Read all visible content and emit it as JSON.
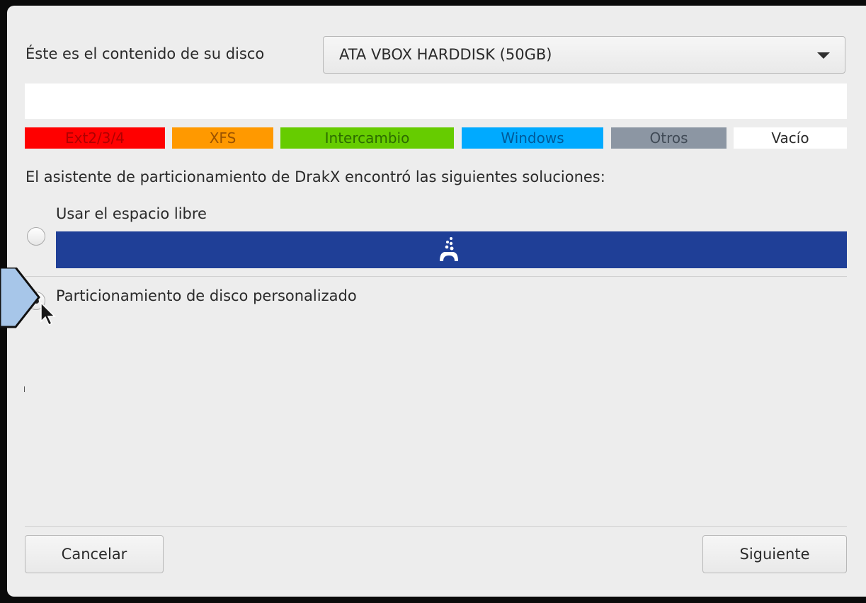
{
  "disk": {
    "label": "Éste es el contenido de su disco",
    "selected": "ATA VBOX HARDDISK (50GB)"
  },
  "legend": [
    {
      "label": "Ext2/3/4",
      "color": "#ff0000",
      "text_color": "#b00000"
    },
    {
      "label": "XFS",
      "color": "#ff9900",
      "text_color": "#9a5200"
    },
    {
      "label": "Intercambio",
      "color": "#66cc00",
      "text_color": "#2c6b00"
    },
    {
      "label": "Windows",
      "color": "#00aaff",
      "text_color": "#005a99"
    },
    {
      "label": "Otros",
      "color": "#8c96a3",
      "text_color": "#404a56"
    },
    {
      "label": "Vacío",
      "color": "#ffffff",
      "text_color": "#2a2a2a"
    }
  ],
  "wizard_text": "El asistente de particionamiento de DrakX encontró las siguientes soluciones:",
  "options": {
    "free_space": {
      "label": "Usar el espacio libre",
      "selected": false
    },
    "custom": {
      "label": "Particionamiento de disco personalizado",
      "selected": true
    }
  },
  "free_space_bar_color": "#1f3f97",
  "icons": {
    "partition_icon": "drakx-partition-icon",
    "cursor": "mouse-pointer-icon",
    "dropdown": "chevron-down-icon"
  },
  "buttons": {
    "cancel": "Cancelar",
    "next": "Siguiente"
  }
}
